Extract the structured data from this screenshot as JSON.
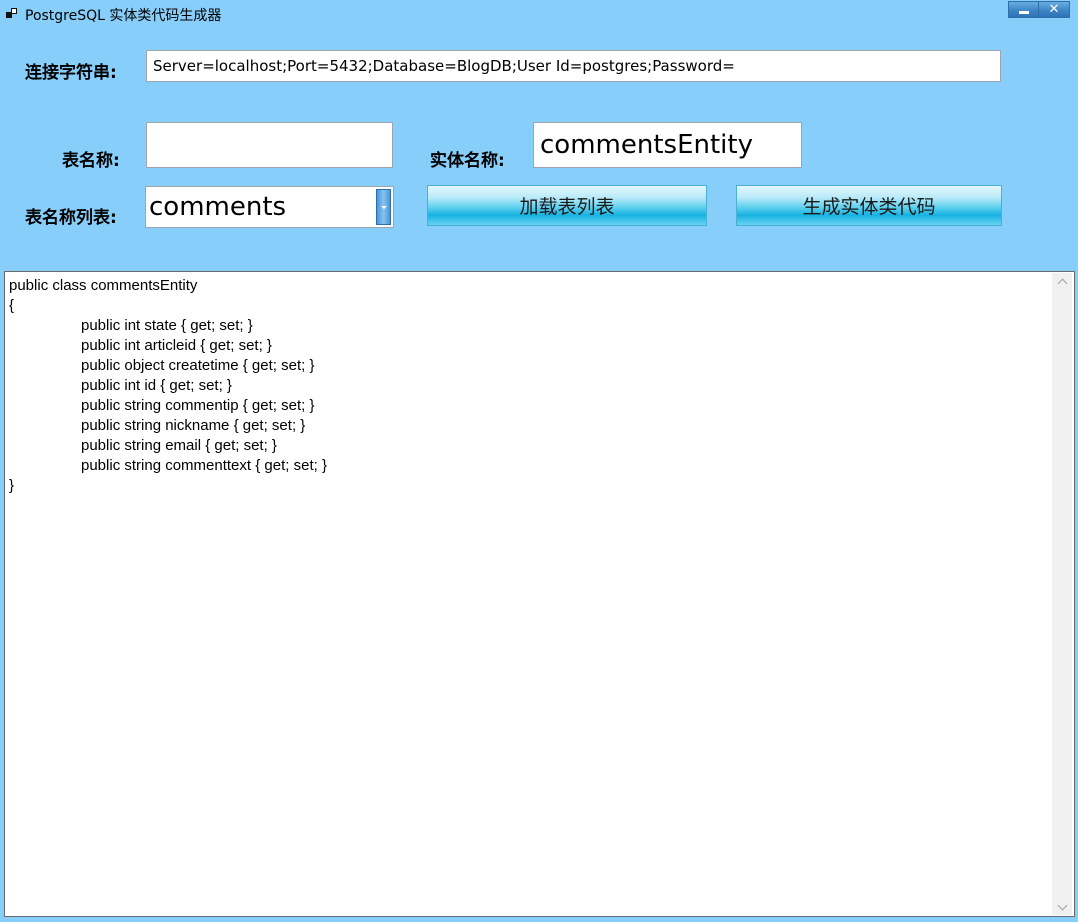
{
  "window": {
    "title": "PostgreSQL 实体类代码生成器",
    "close_glyph": "✕",
    "icons": {
      "app": "app-window-icon",
      "minimize": "minimize-icon",
      "close": "close-icon"
    }
  },
  "form": {
    "connection_label": "连接字符串:",
    "connection_value": "Server=localhost;Port=5432;Database=BlogDB;User Id=postgres;Password=",
    "table_name_label": "表名称:",
    "table_name_value": "",
    "entity_name_label": "实体名称:",
    "entity_name_value": "commentsEntity",
    "table_list_label": "表名称列表:",
    "table_list_selected": "comments",
    "load_button": "加载表列表",
    "generate_button": "生成实体类代码"
  },
  "code": {
    "lines": [
      "public class commentsEntity",
      "{",
      "public int state { get; set; }",
      "public int articleid { get; set; }",
      "public object createtime { get; set; }",
      "public int id { get; set; }",
      "public string commentip { get; set; }",
      "public string nickname { get; set; }",
      "public string email { get; set; }",
      "public string commenttext { get; set; }",
      "}"
    ]
  }
}
